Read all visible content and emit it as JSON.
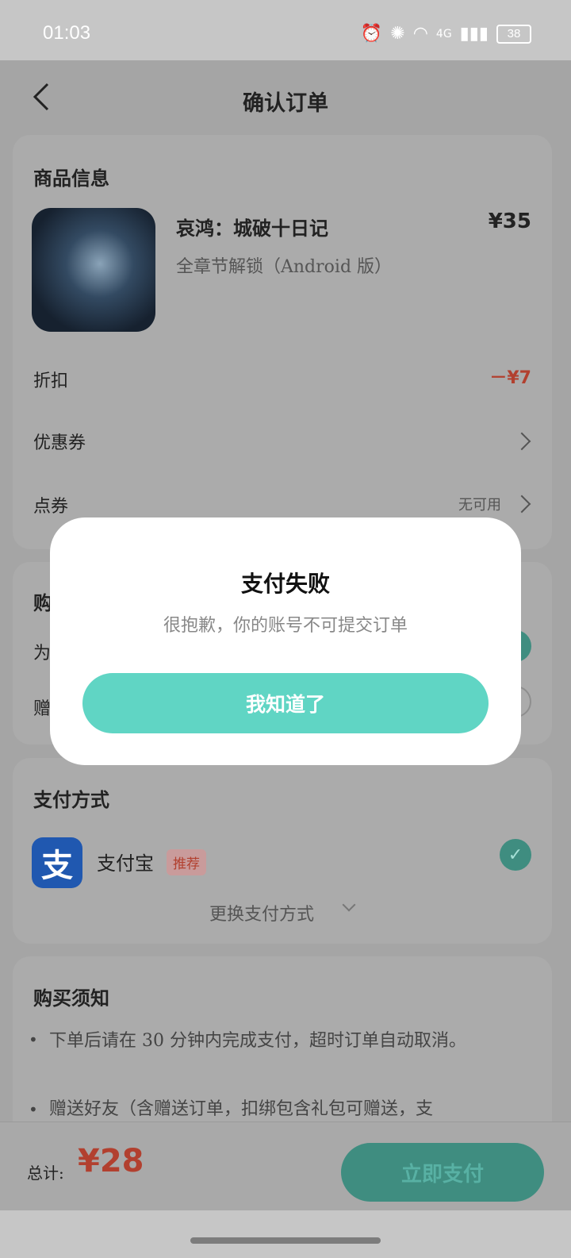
{
  "status_bar": {
    "time": "01:03",
    "battery": "38",
    "network": "4G"
  },
  "header": {
    "title": "确认订单"
  },
  "product": {
    "section_title": "商品信息",
    "name": "哀鸿：城破十日记",
    "subtitle": "全章节解锁（Android 版）",
    "price": "¥35"
  },
  "discount": {
    "label": "折扣",
    "value": "－¥7"
  },
  "coupon": {
    "label": "优惠券"
  },
  "voucher": {
    "label": "点券",
    "value": "无可用"
  },
  "purchase_section": {
    "title_partial": "购",
    "option1_partial": "为",
    "option2_partial": "赠"
  },
  "dialog": {
    "title": "支付失败",
    "message": "很抱歉，你的账号不可提交订单",
    "button": "我知道了"
  },
  "payment": {
    "section_title": "支付方式",
    "method": "支付宝",
    "method_icon": "支",
    "badge": "推荐",
    "change_label": "更换支付方式"
  },
  "notice": {
    "title": "购买须知",
    "items": [
      "下单后请在 30 分钟内完成支付，超时订单自动取消。",
      "赠送好友（含赠送订单，扣绑包含礼包可赠送，支"
    ]
  },
  "footer": {
    "total_label": "总计:",
    "total_value": "¥28",
    "pay_button": "立即支付"
  },
  "colors": {
    "accent": "#60d5c4",
    "danger": "#b2402f",
    "dialog_bg": "#ffffff"
  }
}
